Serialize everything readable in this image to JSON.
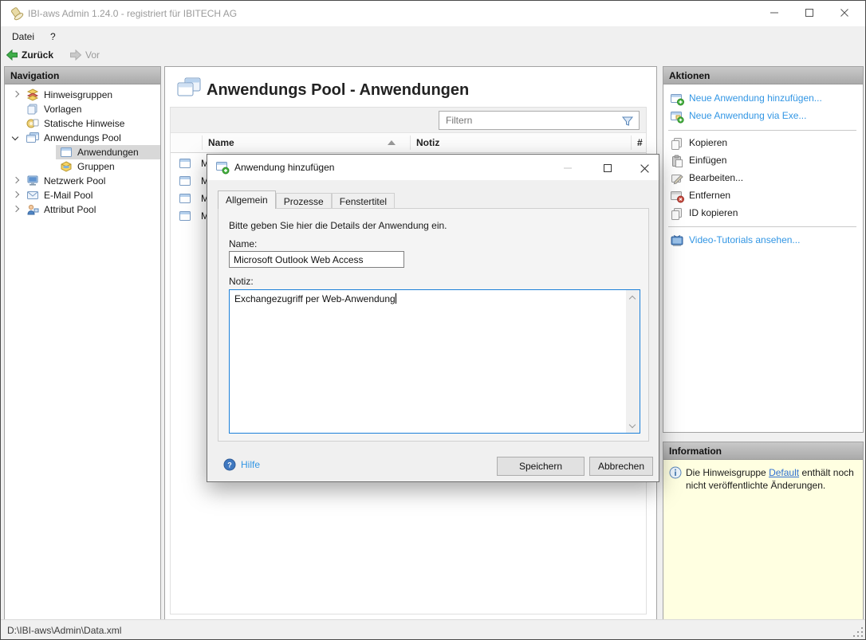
{
  "titlebar": {
    "title": "IBI-aws Admin 1.24.0 - registriert für IBITECH AG"
  },
  "menubar": {
    "file": "Datei",
    "help": "?"
  },
  "toolbar": {
    "back": "Zurück",
    "forward": "Vor"
  },
  "navigation": {
    "header": "Navigation",
    "items": [
      {
        "label": "Hinweisgruppen"
      },
      {
        "label": "Vorlagen"
      },
      {
        "label": "Statische Hinweise"
      },
      {
        "label": "Anwendungs Pool"
      },
      {
        "label": "Anwendungen"
      },
      {
        "label": "Gruppen"
      },
      {
        "label": "Netzwerk Pool"
      },
      {
        "label": "E-Mail Pool"
      },
      {
        "label": "Attribut Pool"
      }
    ]
  },
  "main": {
    "title": "Anwendungs Pool - Anwendungen",
    "filter": {
      "placeholder": "Filtern"
    },
    "table": {
      "col_name": "Name",
      "col_note": "Notiz",
      "col_count": "#",
      "rows": [
        {
          "name": "M"
        },
        {
          "name": "M"
        },
        {
          "name": "M"
        },
        {
          "name": "M"
        }
      ]
    }
  },
  "actions": {
    "header": "Aktionen",
    "new_app": "Neue Anwendung hinzufügen...",
    "new_app_exe": "Neue Anwendung via Exe...",
    "copy": "Kopieren",
    "paste": "Einfügen",
    "edit": "Bearbeiten...",
    "remove": "Entfernen",
    "copy_id": "ID kopieren",
    "video": "Video-Tutorials ansehen..."
  },
  "information": {
    "header": "Information",
    "text_start": "Die Hinweisgruppe",
    "link": "Default",
    "text_end": "enthält noch nicht veröffentlichte Änderungen."
  },
  "dialog": {
    "title": "Anwendung hinzufügen",
    "tabs": {
      "general": "Allgemein",
      "processes": "Prozesse",
      "window_titles": "Fenstertitel"
    },
    "intro": "Bitte geben Sie hier die Details der Anwendung ein.",
    "name_label": "Name:",
    "name_value": "Microsoft Outlook Web Access",
    "note_label": "Notiz:",
    "note_value": "Exchangezugriff per Web-Anwendung",
    "help": "Hilfe",
    "save": "Speichern",
    "cancel": "Abbrechen"
  },
  "statusbar": {
    "path": "D:\\IBI-aws\\Admin\\Data.xml"
  },
  "colors": {
    "link_blue": "#3296e4",
    "info_bg": "#ffffe1",
    "focus_blue": "#1c80d9",
    "header_gray": "#b5b5b5",
    "back_green": "#3fae49"
  }
}
